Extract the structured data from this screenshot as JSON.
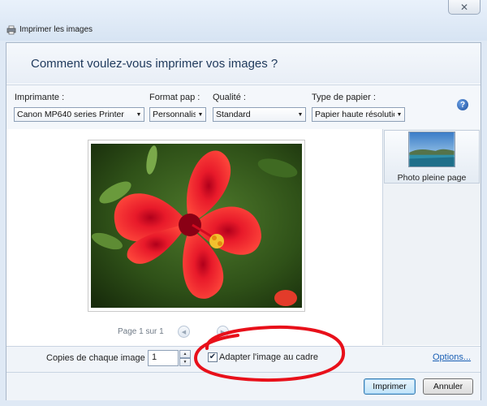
{
  "window": {
    "title": "Imprimer les images",
    "close_glyph": "✕"
  },
  "header": {
    "question": "Comment voulez-vous imprimer vos images ?"
  },
  "options": {
    "printer": {
      "label": "Imprimante :",
      "value": "Canon MP640 series Printer"
    },
    "paper_size": {
      "label": "Format pap :",
      "value": "Personnalisé"
    },
    "quality": {
      "label": "Qualité :",
      "value": "Standard"
    },
    "paper_type": {
      "label": "Type de papier :",
      "value": "Papier haute résolution"
    },
    "help_glyph": "?"
  },
  "preview": {
    "page_indicator": "Page 1 sur 1",
    "prev_glyph": "◀",
    "next_glyph": "▶",
    "photo_description_icon": "hibiscus-photo"
  },
  "layouts": {
    "selected_label": "Photo pleine page"
  },
  "footer": {
    "copies_label": "Copies de chaque image :",
    "copies_value": "1",
    "step_up": "▲",
    "step_down": "▼",
    "fit_label": "Adapter l'image au cadre",
    "fit_checked_glyph": "✔",
    "options_link": "Options...",
    "print_button": "Imprimer",
    "cancel_button": "Annuler"
  },
  "colors": {
    "annotation": "#e8101a",
    "accent_link": "#1a5fb4"
  }
}
